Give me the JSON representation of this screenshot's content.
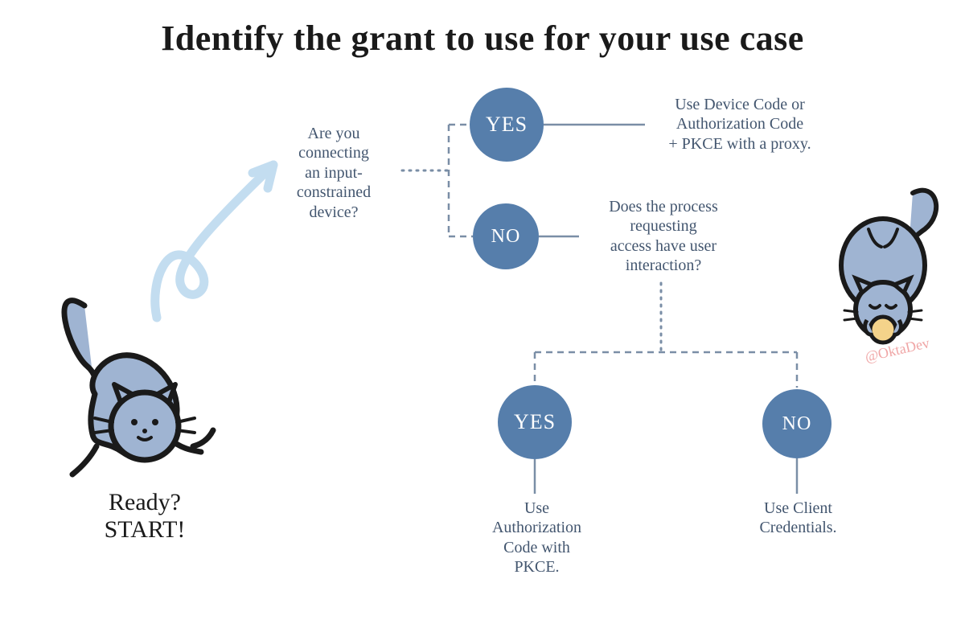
{
  "title": "Identify the grant to use for your use case",
  "ready": {
    "line1": "Ready?",
    "line2": "START!"
  },
  "question1": {
    "l1": "Are you",
    "l2": "connecting",
    "l3": "an input-",
    "l4": "constrained",
    "l5": "device?"
  },
  "answer1_yes_label": "YES",
  "answer1_yes_result": {
    "l1": "Use Device Code or",
    "l2": "Authorization Code",
    "l3": "+ PKCE with a proxy."
  },
  "answer1_no_label": "NO",
  "question2": {
    "l1": "Does the process",
    "l2": "requesting",
    "l3": "access have user",
    "l4": "interaction?"
  },
  "answer2_yes_label": "YES",
  "answer2_yes_result": {
    "l1": "Use",
    "l2": "Authorization",
    "l3": "Code with",
    "l4": "PKCE."
  },
  "answer2_no_label": "NO",
  "answer2_no_result": {
    "l1": "Use Client",
    "l2": "Credentials."
  },
  "handle": "@OktaDev"
}
